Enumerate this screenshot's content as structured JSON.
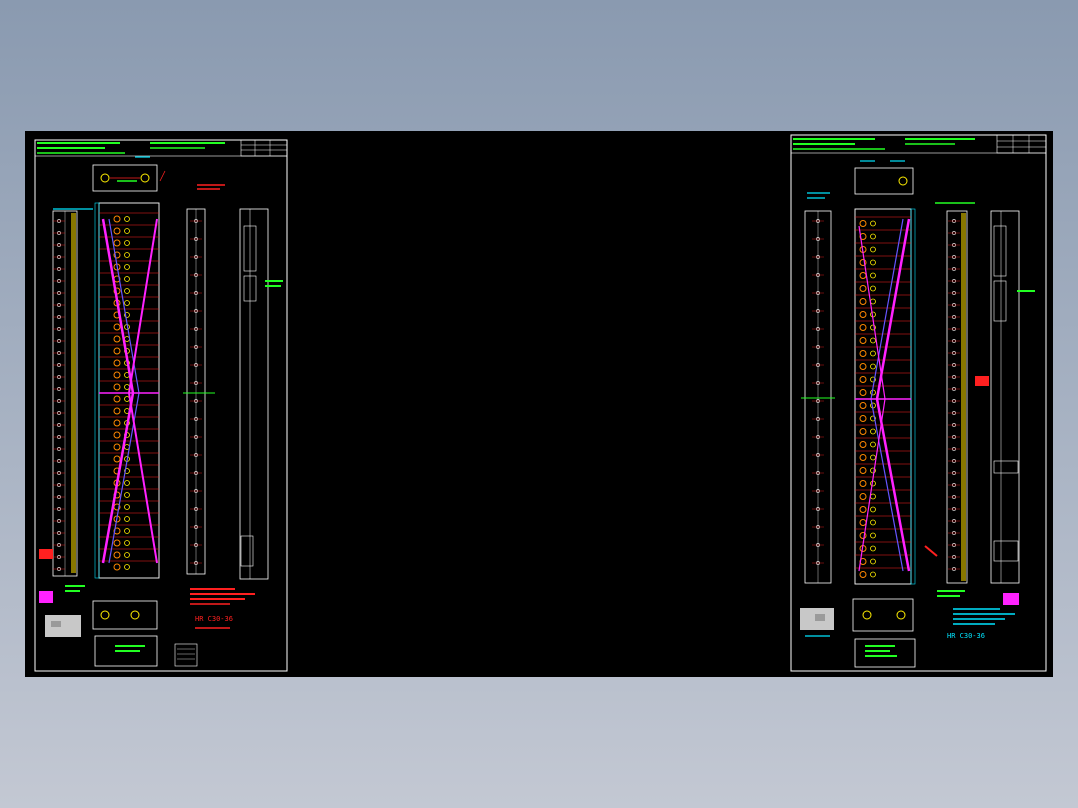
{
  "left_sheet": {
    "part_label": "HR C30-36"
  },
  "right_sheet": {
    "part_label": "HR C30-36"
  },
  "colors": {
    "background": "#000000",
    "border": "#ffffff",
    "cyan": "#00e5ff",
    "green": "#22ff22",
    "yellow": "#ffee00",
    "red": "#ff2020",
    "magenta": "#ff22ff",
    "orange": "#ff8800"
  }
}
